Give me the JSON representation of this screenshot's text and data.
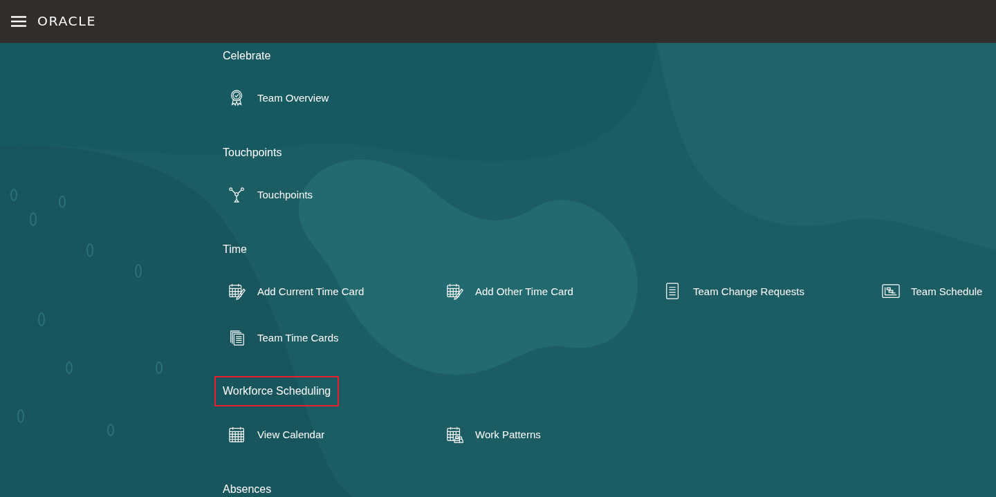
{
  "header": {
    "logo": "ORACLE"
  },
  "sections": [
    {
      "title": "Celebrate",
      "highlighted": false,
      "items": [
        {
          "label": "Team Overview"
        }
      ]
    },
    {
      "title": "Touchpoints",
      "highlighted": false,
      "items": [
        {
          "label": "Touchpoints"
        }
      ]
    },
    {
      "title": "Time",
      "highlighted": false,
      "items": [
        {
          "label": "Add Current Time Card"
        },
        {
          "label": "Add Other Time Card"
        },
        {
          "label": "Team Change Requests"
        },
        {
          "label": "Team Schedule"
        },
        {
          "label": "Team Time Cards"
        }
      ]
    },
    {
      "title": "Workforce Scheduling",
      "highlighted": true,
      "items": [
        {
          "label": "View Calendar"
        },
        {
          "label": "Work Patterns"
        }
      ]
    },
    {
      "title": "Absences",
      "highlighted": false
    }
  ]
}
